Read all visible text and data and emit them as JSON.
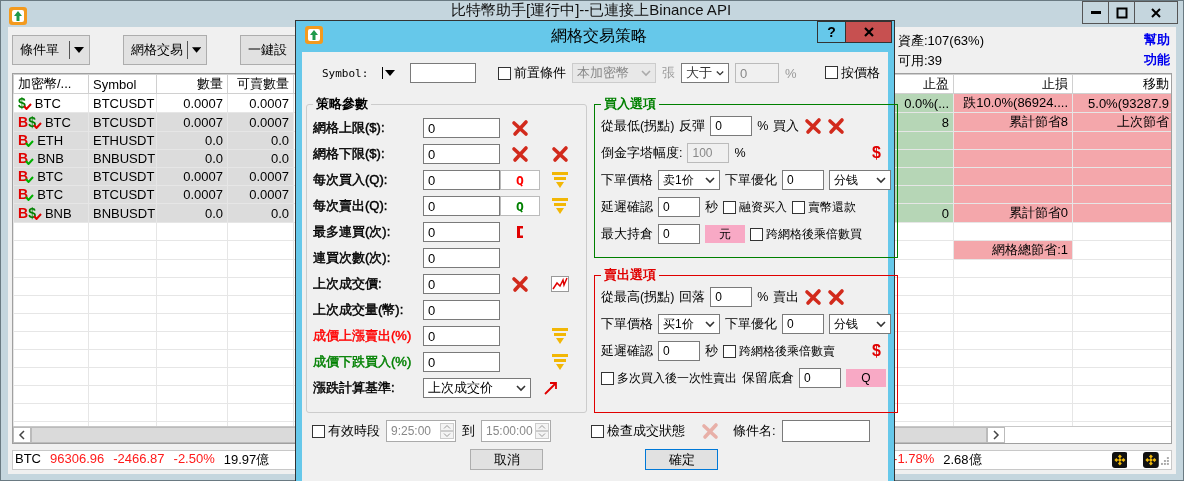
{
  "window": {
    "title": "比特幣助手[運行中]--已連接上Binance API"
  },
  "toolbar": {
    "buttons": [
      {
        "label": "條件單",
        "dropdown": true
      },
      {
        "label": "網格交易",
        "dropdown": true
      },
      {
        "label": "一鍵設"
      }
    ],
    "account": [
      "資產:107(63%)",
      "可用:39"
    ],
    "links": [
      "幫助",
      "功能"
    ]
  },
  "table": {
    "columns": [
      "加密幣/...",
      "Symbol",
      "數量",
      "可賣數量",
      "止盈",
      "止損",
      "移動"
    ],
    "rows": [
      {
        "selected": false,
        "marks": [
          {
            "text": "$",
            "color": "#008000"
          }
        ],
        "tick": {
          "color": "#e00000"
        },
        "coin": "BTC",
        "symbol": "BTCUSDT",
        "qty": "0.0007",
        "sellable": "0.0007",
        "take_profit": "0.0%(...",
        "stop_loss": "跌10.0%(86924....",
        "trailing": "5.0%(93287.9"
      },
      {
        "selected": true,
        "marks": [
          {
            "text": "B",
            "color": "#e00000"
          },
          {
            "text": "$",
            "color": "#008000"
          }
        ],
        "tick": {
          "color": "#e00000"
        },
        "coin": "BTC",
        "symbol": "BTCUSDT",
        "qty": "0.0007",
        "sellable": "0.0007",
        "take_profit": "8",
        "stop_loss": "累計節省8",
        "trailing": "上次節省"
      },
      {
        "selected": true,
        "marks": [
          {
            "text": "B",
            "color": "#e00000"
          }
        ],
        "tick": {
          "color": "#00b000"
        },
        "coin": "ETH",
        "symbol": "ETHUSDT",
        "qty": "0.0",
        "sellable": "0.0"
      },
      {
        "selected": true,
        "marks": [
          {
            "text": "B",
            "color": "#e00000"
          }
        ],
        "tick": {
          "color": "#00b000"
        },
        "coin": "BNB",
        "symbol": "BNBUSDT",
        "qty": "0.0",
        "sellable": "0.0"
      },
      {
        "selected": true,
        "marks": [
          {
            "text": "B",
            "color": "#e00000"
          }
        ],
        "tick": {
          "color": "#00b000"
        },
        "coin": "BTC",
        "symbol": "BTCUSDT",
        "qty": "0.0007",
        "sellable": "0.0007"
      },
      {
        "selected": true,
        "marks": [
          {
            "text": "B",
            "color": "#e00000"
          }
        ],
        "tick": {
          "color": "#00b000"
        },
        "coin": "BTC",
        "symbol": "BTCUSDT",
        "qty": "0.0007",
        "sellable": "0.0007"
      },
      {
        "selected": true,
        "marks": [
          {
            "text": "B",
            "color": "#e00000"
          },
          {
            "text": "$",
            "color": "#008000"
          }
        ],
        "tick": {
          "color": "#e00000"
        },
        "coin": "BNB",
        "symbol": "BNBUSDT",
        "qty": "0.0",
        "sellable": "0.0",
        "take_profit": "0",
        "stop_loss": "累計節省0"
      }
    ],
    "summary": {
      "stop_loss": "網格總節省:1"
    }
  },
  "status_bar": {
    "left": [
      {
        "text": "BTC",
        "negative": false
      },
      {
        "text": "96306.96",
        "negative": true
      },
      {
        "text": "-2466.87",
        "negative": true
      },
      {
        "text": "-2.50%",
        "negative": true
      },
      {
        "text": "19.97億",
        "negative": false
      }
    ],
    "right": [
      {
        "text": "-1.78%",
        "negative": true
      },
      {
        "text": "2.68億",
        "negative": false
      }
    ]
  },
  "dialog": {
    "title": "網格交易策略",
    "help": "?",
    "symbol": {
      "label": "Symbol:"
    },
    "precondition": {
      "label": "前置條件",
      "checked": false,
      "coin": "本加密幣",
      "unit": "張",
      "operator": "大于",
      "value": "0",
      "percent": "%"
    },
    "by_price": {
      "label": "按價格",
      "checked": false
    },
    "params": {
      "title": "策略參數",
      "rows": [
        {
          "label": "網格上限($):",
          "kind": "field",
          "value": "0",
          "extras": [
            {
              "kind": "clear"
            }
          ]
        },
        {
          "label": "網格下限($):",
          "kind": "field",
          "value": "0",
          "extras": [
            {
              "kind": "clear"
            },
            {
              "kind": "clear"
            }
          ]
        },
        {
          "label": "每次買入(Q):",
          "kind": "field",
          "value": "0",
          "extras": [
            {
              "kind": "unit",
              "text": "Q",
              "color": "#ff0000"
            },
            {
              "kind": "funnel"
            }
          ]
        },
        {
          "label": "每次賣出(Q):",
          "kind": "field",
          "value": "0",
          "extras": [
            {
              "kind": "unit",
              "text": "Q",
              "color": "#008000"
            },
            {
              "kind": "funnel"
            }
          ]
        },
        {
          "label": "最多連買(次):",
          "kind": "field",
          "value": "0",
          "extras": [
            {
              "kind": "bracket"
            }
          ]
        },
        {
          "label": "連買次數(次):",
          "kind": "field",
          "value": "0",
          "extras": []
        },
        {
          "label": "上次成交價:",
          "kind": "field",
          "value": "0",
          "extras": [
            {
              "kind": "clear"
            },
            {
              "kind": "chart"
            }
          ]
        },
        {
          "label": "上次成交量(幣):",
          "kind": "field",
          "value": "0",
          "extras": []
        },
        {
          "label": "成價上漲賣出(%)",
          "color": "#ff0000",
          "kind": "field",
          "value": "0",
          "extras": [
            {
              "kind": "gap"
            },
            {
              "kind": "funnel"
            }
          ]
        },
        {
          "label": "成價下跌買入(%)",
          "color": "#008000",
          "kind": "field",
          "value": "0",
          "extras": [
            {
              "kind": "gap"
            },
            {
              "kind": "funnel"
            }
          ]
        },
        {
          "label": "漲跌計算基準:",
          "kind": "select",
          "value": "上次成交价",
          "extras": [
            {
              "kind": "arrow"
            }
          ]
        }
      ]
    },
    "groups": [
      {
        "title": "買入選項",
        "color": "#008000",
        "rows": [
          {
            "items": [
              {
                "kind": "text",
                "text": "從最低(拐點)"
              },
              {
                "kind": "text",
                "text": "反彈"
              },
              {
                "kind": "field",
                "value": "0",
                "disabled": false
              },
              {
                "kind": "text",
                "text": "%"
              },
              {
                "kind": "text",
                "text": "買入"
              },
              {
                "kind": "clear"
              },
              {
                "kind": "clear"
              }
            ]
          },
          {
            "items": [
              {
                "kind": "text",
                "text": "倒金字塔幅度:"
              },
              {
                "kind": "field",
                "value": "100",
                "disabled": true
              },
              {
                "kind": "text",
                "text": "%"
              },
              {
                "kind": "sign",
                "text": "$"
              }
            ]
          },
          {
            "items": [
              {
                "kind": "text",
                "text": "下單價格"
              },
              {
                "kind": "select",
                "value": "卖1价"
              },
              {
                "kind": "text",
                "text": "下單優化"
              },
              {
                "kind": "field",
                "value": "0",
                "disabled": false
              },
              {
                "kind": "select",
                "value": "分钱"
              }
            ]
          },
          {
            "items": [
              {
                "kind": "text",
                "text": "延遲確認"
              },
              {
                "kind": "field",
                "value": "0",
                "disabled": false
              },
              {
                "kind": "text",
                "text": "秒"
              },
              {
                "kind": "check",
                "label": "融资买入",
                "checked": false
              },
              {
                "kind": "check",
                "label": "賣幣還款",
                "checked": false
              }
            ]
          },
          {
            "items": [
              {
                "kind": "text",
                "text": "最大持倉"
              },
              {
                "kind": "field",
                "value": "0",
                "disabled": false
              },
              {
                "kind": "tag",
                "text": "元"
              },
              {
                "kind": "check",
                "label": "跨網格後乘倍數買",
                "checked": false
              }
            ]
          }
        ]
      },
      {
        "title": "賣出選項",
        "color": "#e00000",
        "rows": [
          {
            "items": [
              {
                "kind": "text",
                "text": "從最高(拐點)"
              },
              {
                "kind": "text",
                "text": "回落"
              },
              {
                "kind": "field",
                "value": "0",
                "disabled": false
              },
              {
                "kind": "text",
                "text": "%"
              },
              {
                "kind": "text",
                "text": "賣出"
              },
              {
                "kind": "clear"
              },
              {
                "kind": "clear"
              }
            ]
          },
          {
            "items": [
              {
                "kind": "text",
                "text": "下單價格"
              },
              {
                "kind": "select",
                "value": "买1价"
              },
              {
                "kind": "text",
                "text": "下單優化"
              },
              {
                "kind": "field",
                "value": "0",
                "disabled": false
              },
              {
                "kind": "select",
                "value": "分钱"
              }
            ]
          },
          {
            "items": [
              {
                "kind": "text",
                "text": "延遲確認"
              },
              {
                "kind": "field",
                "value": "0",
                "disabled": false
              },
              {
                "kind": "text",
                "text": "秒"
              },
              {
                "kind": "check",
                "label": "跨網格後乘倍數賣",
                "checked": false
              },
              {
                "kind": "sign",
                "text": "$"
              }
            ]
          },
          {
            "items": [
              {
                "kind": "check",
                "label": "多次買入後一次性賣出",
                "checked": false
              },
              {
                "kind": "text",
                "text": "保留底倉"
              },
              {
                "kind": "field",
                "value": "0",
                "disabled": false
              },
              {
                "kind": "tag",
                "text": "Q"
              }
            ]
          }
        ]
      }
    ],
    "schedule": {
      "label": "有效時段",
      "checked": false,
      "start": "9:25:00",
      "to": "到",
      "end": "15:00:00"
    },
    "check_status": {
      "label": "檢查成交狀態",
      "checked": false
    },
    "name": {
      "label": "條件名:"
    },
    "buttons": [
      "取消",
      "確定"
    ]
  }
}
